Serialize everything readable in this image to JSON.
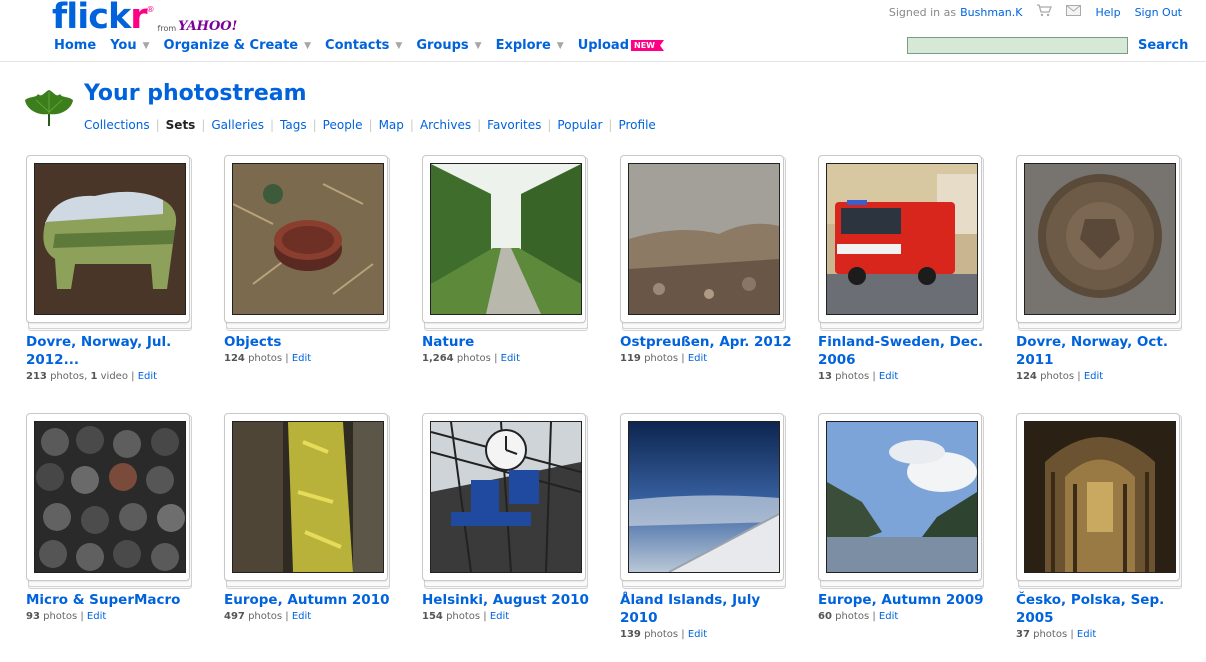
{
  "logo": {
    "part1": "flick",
    "part2": "r",
    "reg": "®",
    "from": "from",
    "yahoo": "YAHOO!"
  },
  "nav": {
    "home": "Home",
    "you": "You",
    "organize": "Organize & Create",
    "contacts": "Contacts",
    "groups": "Groups",
    "explore": "Explore",
    "upload": "Upload",
    "new_badge": "NEW"
  },
  "userbar": {
    "signed_in_as": "Signed in as",
    "username": "Bushman.K",
    "help": "Help",
    "sign_out": "Sign Out"
  },
  "search": {
    "button": "Search",
    "value": ""
  },
  "page": {
    "title": "Your photostream"
  },
  "subnav": [
    "Collections",
    "Sets",
    "Galleries",
    "Tags",
    "People",
    "Map",
    "Archives",
    "Favorites",
    "Popular",
    "Profile"
  ],
  "edit_label": "Edit",
  "photos_label": "photos",
  "sets": [
    {
      "title": "Dovre, Norway, Jul. 2012...",
      "count": "213",
      "video_count": "1",
      "video_label": "video"
    },
    {
      "title": "Objects",
      "count": "124"
    },
    {
      "title": "Nature",
      "count": "1,264"
    },
    {
      "title": "Ostpreußen, Apr. 2012",
      "count": "119"
    },
    {
      "title": "Finland-Sweden, Dec. 2006",
      "count": "13"
    },
    {
      "title": "Dovre, Norway, Oct. 2011",
      "count": "124"
    },
    {
      "title": "Micro & SuperMacro",
      "count": "93"
    },
    {
      "title": "Europe, Autumn 2010",
      "count": "497"
    },
    {
      "title": "Helsinki, August 2010",
      "count": "154"
    },
    {
      "title": "Åland Islands, July 2010",
      "count": "139"
    },
    {
      "title": "Europe, Autumn 2009",
      "count": "60"
    },
    {
      "title": "Česko, Polska, Sep. 2005",
      "count": "37"
    }
  ],
  "colors": {
    "link": "#0063dc",
    "brand_pink": "#ff0084",
    "search_bg": "#d6e9d6"
  }
}
